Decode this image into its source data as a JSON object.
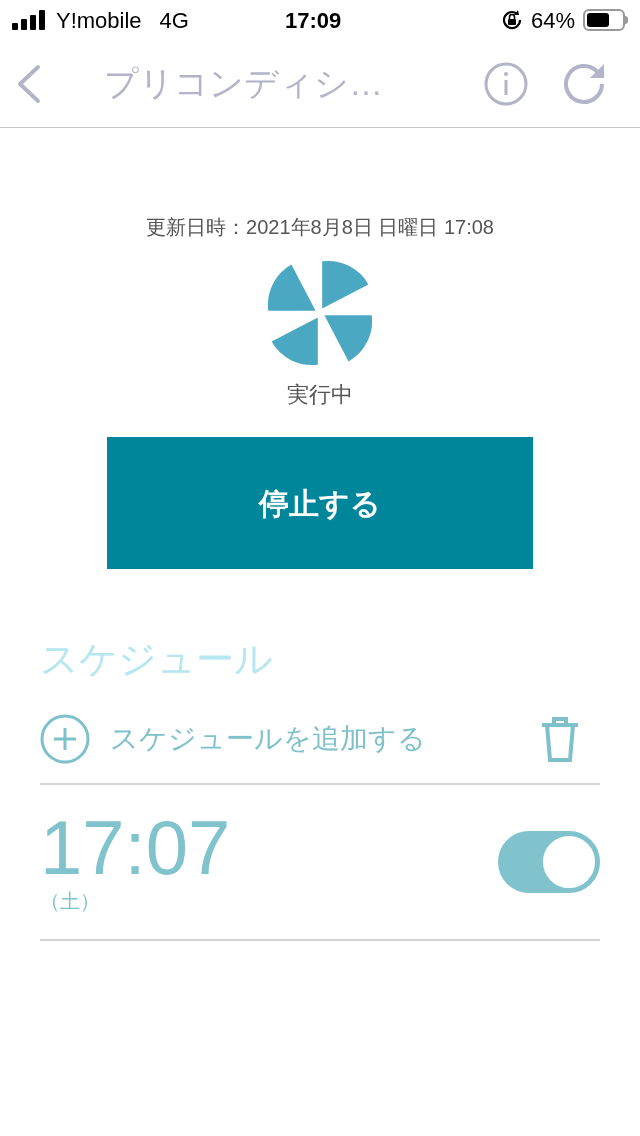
{
  "status_bar": {
    "carrier": "Y!mobile",
    "network": "4G",
    "time": "17:09",
    "battery": "64%"
  },
  "nav": {
    "title": "プリコンディシ…"
  },
  "updated": "更新日時：2021年8月8日 日曜日 17:08",
  "state_label": "実行中",
  "stop_button": "停止する",
  "schedule": {
    "heading": "スケジュール",
    "add_label": "スケジュールを追加する",
    "items": [
      {
        "time": "17:07",
        "day": "（土）",
        "on": true
      }
    ]
  }
}
